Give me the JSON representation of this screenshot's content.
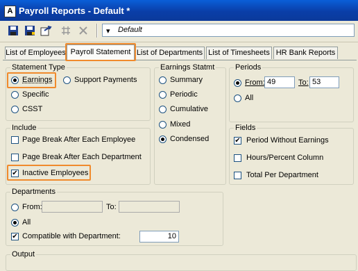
{
  "window": {
    "title": "Payroll Reports - Default *"
  },
  "toolbar": {
    "template_value": "Default"
  },
  "tabs": [
    {
      "label": "List of Employees"
    },
    {
      "label": "Payroll Statement"
    },
    {
      "label": "List of Departments"
    },
    {
      "label": "List of Timesheets"
    },
    {
      "label": "HR Bank Reports"
    }
  ],
  "statement_type": {
    "legend": "Statement Type",
    "options": [
      "Earnings",
      "Support Payments",
      "Specific",
      "CSST"
    ],
    "selected": "Earnings"
  },
  "earnings_statmt": {
    "legend": "Earnings Statmt",
    "options": [
      "Summary",
      "Periodic",
      "Cumulative",
      "Mixed",
      "Condensed"
    ],
    "selected": "Condensed"
  },
  "periods": {
    "legend": "Periods",
    "from_label": "From:",
    "from_value": "49",
    "to_label": "To:",
    "to_value": "53",
    "all_label": "All",
    "selected": "From"
  },
  "include": {
    "legend": "Include",
    "options": [
      "Page Break After Each Employee",
      "Page Break After Each Department",
      "Inactive Employees"
    ]
  },
  "fields": {
    "legend": "Fields",
    "options": [
      "Period Without Earnings",
      "Hours/Percent Column",
      "Total Per Department"
    ]
  },
  "departments": {
    "legend": "Departments",
    "from_label": "From:",
    "to_label": "To:",
    "all_label": "All",
    "compatible_label": "Compatible with Department:",
    "compatible_value": "10"
  },
  "output": {
    "legend": "Output"
  }
}
